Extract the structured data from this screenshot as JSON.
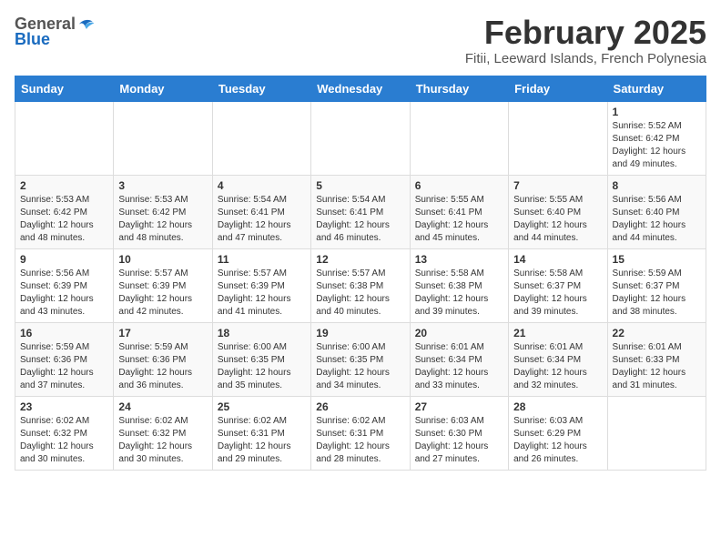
{
  "logo": {
    "general": "General",
    "blue": "Blue"
  },
  "header": {
    "month": "February 2025",
    "location": "Fitii, Leeward Islands, French Polynesia"
  },
  "weekdays": [
    "Sunday",
    "Monday",
    "Tuesday",
    "Wednesday",
    "Thursday",
    "Friday",
    "Saturday"
  ],
  "weeks": [
    [
      {
        "day": "",
        "info": ""
      },
      {
        "day": "",
        "info": ""
      },
      {
        "day": "",
        "info": ""
      },
      {
        "day": "",
        "info": ""
      },
      {
        "day": "",
        "info": ""
      },
      {
        "day": "",
        "info": ""
      },
      {
        "day": "1",
        "info": "Sunrise: 5:52 AM\nSunset: 6:42 PM\nDaylight: 12 hours\nand 49 minutes."
      }
    ],
    [
      {
        "day": "2",
        "info": "Sunrise: 5:53 AM\nSunset: 6:42 PM\nDaylight: 12 hours\nand 48 minutes."
      },
      {
        "day": "3",
        "info": "Sunrise: 5:53 AM\nSunset: 6:42 PM\nDaylight: 12 hours\nand 48 minutes."
      },
      {
        "day": "4",
        "info": "Sunrise: 5:54 AM\nSunset: 6:41 PM\nDaylight: 12 hours\nand 47 minutes."
      },
      {
        "day": "5",
        "info": "Sunrise: 5:54 AM\nSunset: 6:41 PM\nDaylight: 12 hours\nand 46 minutes."
      },
      {
        "day": "6",
        "info": "Sunrise: 5:55 AM\nSunset: 6:41 PM\nDaylight: 12 hours\nand 45 minutes."
      },
      {
        "day": "7",
        "info": "Sunrise: 5:55 AM\nSunset: 6:40 PM\nDaylight: 12 hours\nand 44 minutes."
      },
      {
        "day": "8",
        "info": "Sunrise: 5:56 AM\nSunset: 6:40 PM\nDaylight: 12 hours\nand 44 minutes."
      }
    ],
    [
      {
        "day": "9",
        "info": "Sunrise: 5:56 AM\nSunset: 6:39 PM\nDaylight: 12 hours\nand 43 minutes."
      },
      {
        "day": "10",
        "info": "Sunrise: 5:57 AM\nSunset: 6:39 PM\nDaylight: 12 hours\nand 42 minutes."
      },
      {
        "day": "11",
        "info": "Sunrise: 5:57 AM\nSunset: 6:39 PM\nDaylight: 12 hours\nand 41 minutes."
      },
      {
        "day": "12",
        "info": "Sunrise: 5:57 AM\nSunset: 6:38 PM\nDaylight: 12 hours\nand 40 minutes."
      },
      {
        "day": "13",
        "info": "Sunrise: 5:58 AM\nSunset: 6:38 PM\nDaylight: 12 hours\nand 39 minutes."
      },
      {
        "day": "14",
        "info": "Sunrise: 5:58 AM\nSunset: 6:37 PM\nDaylight: 12 hours\nand 39 minutes."
      },
      {
        "day": "15",
        "info": "Sunrise: 5:59 AM\nSunset: 6:37 PM\nDaylight: 12 hours\nand 38 minutes."
      }
    ],
    [
      {
        "day": "16",
        "info": "Sunrise: 5:59 AM\nSunset: 6:36 PM\nDaylight: 12 hours\nand 37 minutes."
      },
      {
        "day": "17",
        "info": "Sunrise: 5:59 AM\nSunset: 6:36 PM\nDaylight: 12 hours\nand 36 minutes."
      },
      {
        "day": "18",
        "info": "Sunrise: 6:00 AM\nSunset: 6:35 PM\nDaylight: 12 hours\nand 35 minutes."
      },
      {
        "day": "19",
        "info": "Sunrise: 6:00 AM\nSunset: 6:35 PM\nDaylight: 12 hours\nand 34 minutes."
      },
      {
        "day": "20",
        "info": "Sunrise: 6:01 AM\nSunset: 6:34 PM\nDaylight: 12 hours\nand 33 minutes."
      },
      {
        "day": "21",
        "info": "Sunrise: 6:01 AM\nSunset: 6:34 PM\nDaylight: 12 hours\nand 32 minutes."
      },
      {
        "day": "22",
        "info": "Sunrise: 6:01 AM\nSunset: 6:33 PM\nDaylight: 12 hours\nand 31 minutes."
      }
    ],
    [
      {
        "day": "23",
        "info": "Sunrise: 6:02 AM\nSunset: 6:32 PM\nDaylight: 12 hours\nand 30 minutes."
      },
      {
        "day": "24",
        "info": "Sunrise: 6:02 AM\nSunset: 6:32 PM\nDaylight: 12 hours\nand 30 minutes."
      },
      {
        "day": "25",
        "info": "Sunrise: 6:02 AM\nSunset: 6:31 PM\nDaylight: 12 hours\nand 29 minutes."
      },
      {
        "day": "26",
        "info": "Sunrise: 6:02 AM\nSunset: 6:31 PM\nDaylight: 12 hours\nand 28 minutes."
      },
      {
        "day": "27",
        "info": "Sunrise: 6:03 AM\nSunset: 6:30 PM\nDaylight: 12 hours\nand 27 minutes."
      },
      {
        "day": "28",
        "info": "Sunrise: 6:03 AM\nSunset: 6:29 PM\nDaylight: 12 hours\nand 26 minutes."
      },
      {
        "day": "",
        "info": ""
      }
    ]
  ]
}
